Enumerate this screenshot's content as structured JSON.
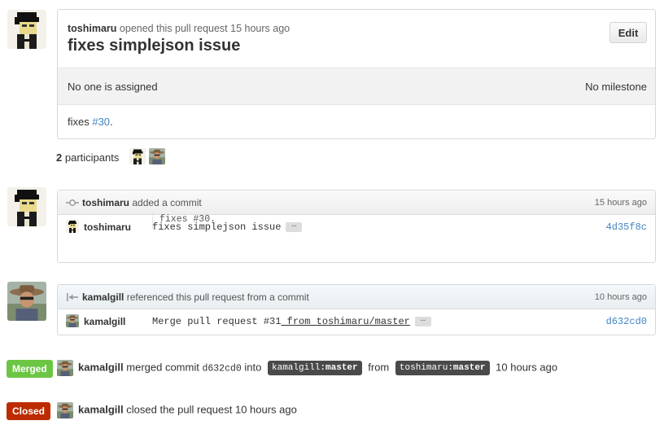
{
  "comment": {
    "author": "toshimaru",
    "action": "opened this pull request 15 hours ago",
    "title": "fixes simplejson issue",
    "edit_label": "Edit",
    "assignee": "No one is assigned",
    "milestone": "No milestone",
    "body_text": "fixes ",
    "body_link": "#30",
    "body_suffix": "."
  },
  "participants": {
    "count": "2",
    "label": "participants"
  },
  "commit_event": {
    "author": "toshimaru",
    "action": "added a commit",
    "time": "15 hours ago",
    "commit_author": "toshimaru",
    "message": "fixes simplejson issue",
    "ellipsis": "…",
    "sha": "4d35f8c",
    "description": "fixes #30."
  },
  "ref_event": {
    "author": "kamalgill",
    "action": "referenced this pull request from a commit",
    "time": "10 hours ago",
    "commit_author": "kamalgill",
    "message_pre": "Merge pull request #31",
    "message_link": " from toshimaru/master",
    "ellipsis": "…",
    "sha": "d632cd0"
  },
  "merged_event": {
    "badge": "Merged",
    "author": "kamalgill",
    "action": "merged commit",
    "sha": "d632cd0",
    "into": "into",
    "base_owner": "kamalgill",
    "base_branch": ":master",
    "from": "from",
    "head_owner": "toshimaru",
    "head_branch": ":master",
    "time": "10 hours ago"
  },
  "closed_event": {
    "badge": "Closed",
    "author": "kamalgill",
    "action": "closed the pull request 10 hours ago"
  },
  "colors": {
    "link": "#4183c4",
    "merged": "#6cc644",
    "closed": "#bd2c00",
    "branch_bg": "#4a4a4a"
  },
  "icons": {
    "commit": "git-commit-icon",
    "reference": "cross-reference-icon"
  }
}
